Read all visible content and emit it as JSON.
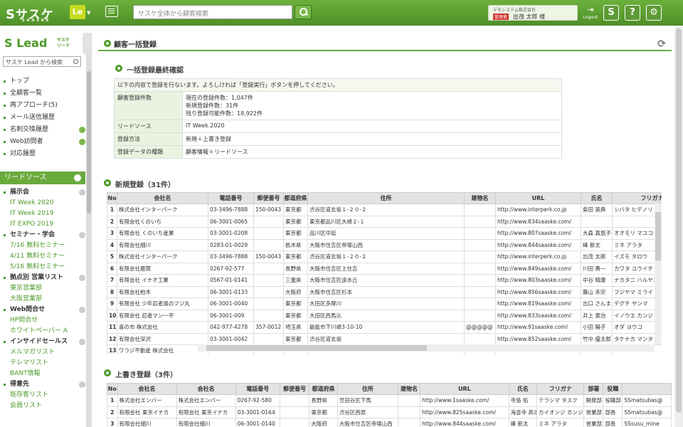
{
  "header": {
    "logo": "サスケ",
    "logo_sub": "SAASKE",
    "app_badge": "Le",
    "search_placeholder": "サスケ全体から顧客検索",
    "company": "デモシステム株式会社",
    "role": "管理者",
    "user_name": "出茂 太郎 様",
    "logout": "Logout",
    "btn1": "S",
    "btn2": "?",
    "btn3": "⚙"
  },
  "sidebar": {
    "brand": "Lead",
    "brand_sub": "サスケ リード",
    "search": "サスケ Lead から検索",
    "items": [
      "トップ",
      "全顧客一覧",
      "再アプローチ(5)",
      "メール送信履歴",
      "名刺交換履歴",
      "Web訪問者",
      "対応履歴"
    ],
    "section": "リードソース",
    "groups": [
      {
        "title": "展示会",
        "children": [
          "IT Week 2020",
          "IT Week 2019",
          "IT EXPO 2019"
        ]
      },
      {
        "title": "セミナー・学会",
        "children": [
          "7/16 無料セミナー",
          "4/11 無料セミナー",
          "5/16 無料セミナー"
        ]
      },
      {
        "title": "拠点別 営業リスト",
        "children": [
          "東京営業部",
          "大阪営業部"
        ]
      },
      {
        "title": "Web問合せ",
        "children": [
          "HP問合せ",
          "ホワイトペーパー A"
        ]
      },
      {
        "title": "インサイドセールス",
        "children": [
          "メルマガリスト",
          "テレマリスト",
          "BANT情報"
        ]
      },
      {
        "title": "得意先",
        "children": [
          "既存客リスト",
          "会員リスト"
        ]
      }
    ]
  },
  "page": {
    "title": "顧客一括登録",
    "confirm_title": "一括登録最終確認",
    "message": "以下の内容で登録を行ないます。よろしければ「登録実行」ボタンを押してください。",
    "rows": [
      {
        "k": "顧客登録件数",
        "v1": "現在の登録件数：1,047件",
        "v2": "新規登録件数：31件",
        "v3": "残り登録可能件数：18,922件"
      },
      {
        "k": "リードソース",
        "v1": "IT Week 2020"
      },
      {
        "k": "登録方法",
        "v1": "新規＋上書き登録"
      },
      {
        "k": "登録データの種類",
        "v1": "顧客情報＋リードソース"
      }
    ],
    "new_title": "新規登録（31件）",
    "update_title": "上書き登録（3件）"
  },
  "new_table": {
    "headers": [
      "No",
      "会社名",
      "電話番号",
      "郵便番号",
      "都道府県",
      "住所",
      "建物名",
      "URL",
      "氏名",
      "フリガナ"
    ],
    "rows": [
      [
        "1",
        "株式会社インターパーク",
        "03-3496-7888",
        "150-0043",
        "東京都",
        "渋谷区道玄坂１-２０-２",
        "",
        "http://www.interperk.co.jp",
        "柴田 英典",
        "シバタ ヒデノリ"
      ],
      [
        "2",
        "有限会社くのいち",
        "06-3001-0065",
        "",
        "東京都",
        "東京都品川区大崎２-１",
        "",
        "http://www.834saaske.com/",
        "",
        ""
      ],
      [
        "3",
        "有限会社 くのいち産業",
        "03-3001-0208",
        "",
        "東京都",
        "品川区中延",
        "",
        "http://www.807saaske.com/",
        "大森 真悠子",
        "オオモリ マユコ"
      ],
      [
        "4",
        "有限会社細川",
        "0283-01-0029",
        "",
        "栃木県",
        "大阪市住吉区帝塚山西",
        "",
        "http://www.844saaske.com/",
        "峰 新太",
        "ミネ アラタ"
      ],
      [
        "5",
        "株式会社インターパーク",
        "03-3496-7888",
        "150-0043",
        "東京都",
        "渋谷区道玄坂１-２０-２",
        "",
        "http://www.interperk.co.jp",
        "出茂 太郎",
        "イズモ タロウ"
      ],
      [
        "6",
        "有限会社鹿賀",
        "0267-92-577",
        "",
        "長野県",
        "大阪市住吉区上住吉",
        "",
        "http://www.849saaske.com/",
        "川田 勇一",
        "カワタ ユウイチ"
      ],
      [
        "7",
        "有限会社 イナオ工業",
        "0567-01-0141",
        "",
        "三重県",
        "大阪市住吉区遠水丘",
        "",
        "http://www.803saaske.com/",
        "中谷 晴康",
        "ナカタニ ハルヤス"
      ],
      [
        "8",
        "有限会社柏木",
        "06-3001-0133",
        "",
        "大阪府",
        "大阪市住吉区杉本",
        "",
        "http://www.856saaske.com/",
        "藤山 禾宗",
        "フジヤマ ミライ"
      ],
      [
        "9",
        "有限会社 少年忍者風のフジ丸",
        "06-3001-0040",
        "",
        "東京都",
        "大田区多摩川",
        "",
        "http://www.819saaske.com/",
        "出口 さんま",
        "デグチ サンマ"
      ],
      [
        "10",
        "有限会社 忍者マン一平",
        "06-3001-009",
        "",
        "東京都",
        "大田区西馬込",
        "",
        "http://www.833saaske.com/",
        "井上 寛治",
        "イノウエ カンジ"
      ],
      [
        "11",
        "喜の市 株式会社",
        "042-977-4278",
        "357-0012",
        "埼玉県",
        "飯能市下川崎3-10-10",
        "@@@@@",
        "http://www.91saaske.com/",
        "小田 陽子",
        "オダ ヨウコ"
      ],
      [
        "12",
        "有限会社深沢",
        "03-3001-0042",
        "",
        "東京都",
        "渋谷区道玄坂",
        "",
        "http://www.852saaske.com/",
        "竹中 優太郎",
        "タケナカ マンタ"
      ],
      [
        "13",
        "ワラジ不動産 株式会社",
        "",
        "",
        "",
        "",
        "",
        "",
        "",
        ""
      ]
    ]
  },
  "update_table": {
    "headers": [
      "No",
      "会社名",
      "会社名",
      "電話番号",
      "郵便番号",
      "都道府県",
      "住所",
      "建物名",
      "URL",
      "氏名",
      "フリガナ",
      "部署",
      "役職",
      ""
    ],
    "rows": [
      [
        "1",
        "株式会社エンバー",
        "株式会社エンバー",
        "0267-92-580",
        "",
        "長野県",
        "世田谷区下馬",
        "",
        "http://www.1saaske.com/",
        "寺島 佑",
        "テラシマ タスク",
        "開発部",
        "役職部",
        "SSmatsubas@"
      ],
      [
        "2",
        "有限会社 東京イナカ",
        "有限会社 東京イナカ",
        "03-3001-0164",
        "",
        "東京都",
        "渋谷区西原",
        "",
        "http://www.825saaske.com/",
        "海音寺 高治",
        "カイオンジ カンジ",
        "営業部",
        "部長",
        "SSmatsubas@"
      ],
      [
        "3",
        "有限会社細川",
        "有限会社細川",
        "06-3001-0140",
        "",
        "大阪府",
        "大阪市住吉区帝塚山西",
        "",
        "http://www.844saaske.com/",
        "峰 新太",
        "ミネ アラタ",
        "営業部",
        "部長",
        "SSsusu_mine"
      ]
    ]
  },
  "colors": {
    "brand": "#4e8f27",
    "accent": "#6aaa3d",
    "header_bg": "#e3e3e3"
  },
  "icons": [
    "chat-icon",
    "search-icon",
    "logout-icon",
    "help-icon",
    "settings-icon",
    "refresh-icon"
  ]
}
